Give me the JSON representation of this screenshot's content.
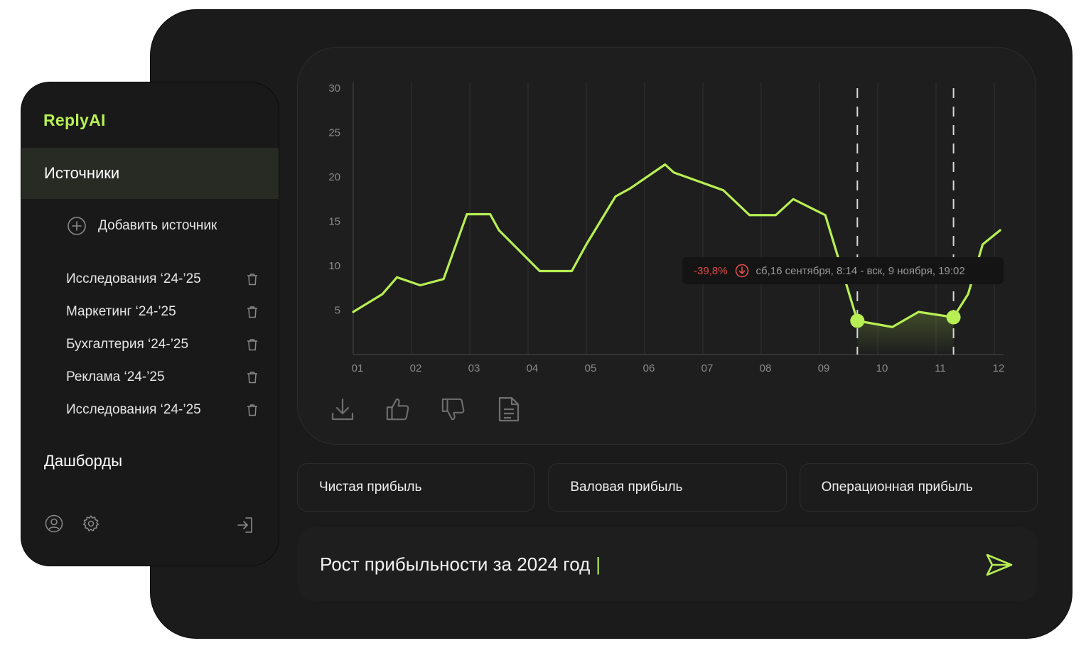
{
  "sidebar": {
    "logo": "ReplyAI",
    "sources_title": "Источники",
    "add_source": "Добавить источник",
    "items": [
      {
        "label": "Исследования ‘24-’25"
      },
      {
        "label": "Маркетинг ‘24-’25"
      },
      {
        "label": "Бухгалтерия ‘24-’25"
      },
      {
        "label": "Реклама ‘24-’25"
      },
      {
        "label": "Исследования ‘24-’25"
      }
    ],
    "dashboards_title": "Дашборды",
    "bottom_icons": [
      "user-icon",
      "gear-icon",
      "logout-icon"
    ]
  },
  "tooltip": {
    "change": "-39,8%",
    "range": "сб,16 сентября, 8:14 - вск, 9 ноября, 19:02"
  },
  "actions": [
    "download-icon",
    "thumbs-up-icon",
    "thumbs-down-icon",
    "document-icon"
  ],
  "chips": [
    "Чистая прибыль",
    "Валовая прибыль",
    "Операционная прибыль"
  ],
  "input": {
    "text": "Рост прибыльности за 2024 год",
    "cursor": "|"
  },
  "colors": {
    "accent": "#b7ef54",
    "negative": "#e04b4b",
    "background": "#1b1b1b"
  },
  "chart_data": {
    "type": "line",
    "x_ticks": [
      "01",
      "02",
      "03",
      "04",
      "05",
      "06",
      "07",
      "08",
      "09",
      "10",
      "11",
      "12"
    ],
    "y_ticks": [
      5,
      10,
      15,
      20,
      25,
      30
    ],
    "ylim": [
      0,
      30
    ],
    "xlim": [
      1,
      12.1
    ],
    "grid": "vertical",
    "x": [
      1,
      1.5,
      1.75,
      2.15,
      2.55,
      2.95,
      3.35,
      3.5,
      4.2,
      4.75,
      5.0,
      5.5,
      5.75,
      6.35,
      6.5,
      7.35,
      7.8,
      8.25,
      8.55,
      9.1,
      9.65,
      10.25,
      10.7,
      11.3,
      11.55,
      11.8,
      12.1
    ],
    "y": [
      4.8,
      6.8,
      8.7,
      7.8,
      8.5,
      15.8,
      15.8,
      14.0,
      9.4,
      9.4,
      12.4,
      17.8,
      18.7,
      21.4,
      20.5,
      18.5,
      15.7,
      15.7,
      17.5,
      15.7,
      3.8,
      3.1,
      4.8,
      4.2,
      6.8,
      12.4,
      14.0
    ],
    "markers": [
      {
        "x": 9.65,
        "y": 3.8
      },
      {
        "x": 11.3,
        "y": 4.2
      }
    ],
    "range_lines_x": [
      9.65,
      11.3
    ]
  }
}
